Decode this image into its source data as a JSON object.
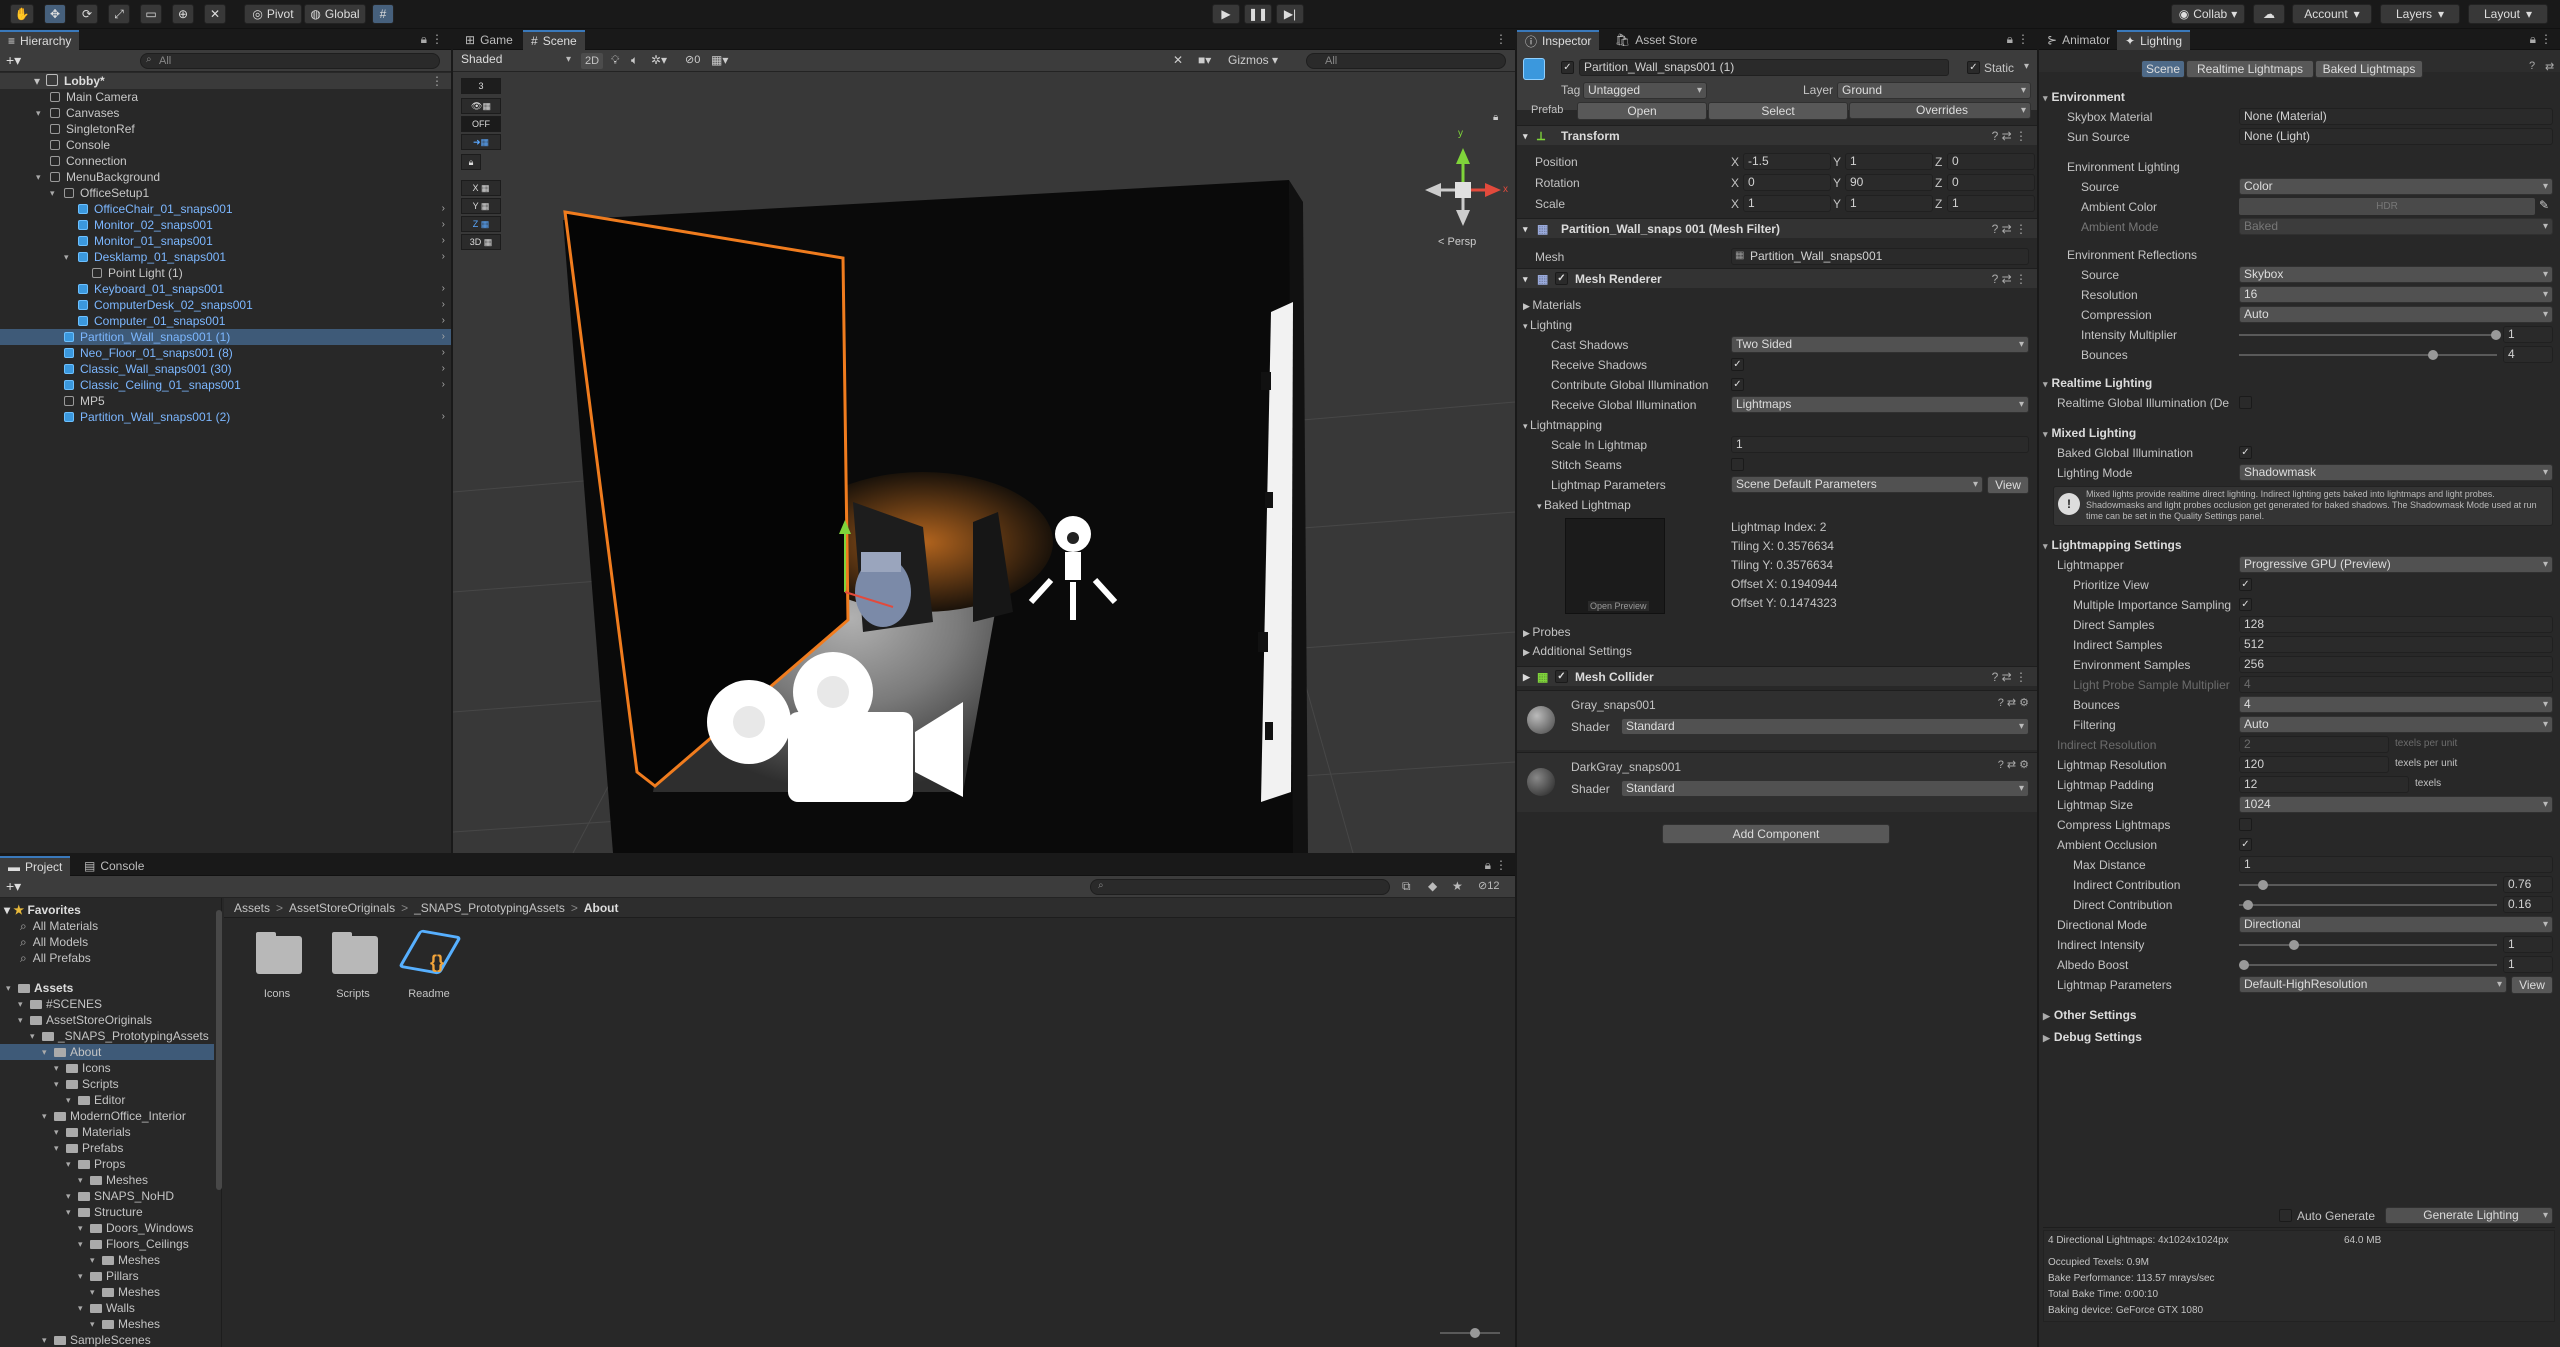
{
  "toolbar": {
    "pivot": "Pivot",
    "global": "Global",
    "collab": "Collab",
    "account": "Account",
    "layers": "Layers",
    "layout": "Layout"
  },
  "hierarchy": {
    "tab": "Hierarchy",
    "search_placeholder": "All",
    "scene": "Lobby*",
    "items": [
      {
        "label": "Main Camera",
        "indent": 1,
        "prefab": false,
        "arrow": false,
        "children": false
      },
      {
        "label": "Canvases",
        "indent": 1,
        "prefab": false,
        "arrow": true,
        "children": false
      },
      {
        "label": "SingletonRef",
        "indent": 1,
        "prefab": false,
        "arrow": false,
        "children": false
      },
      {
        "label": "Console",
        "indent": 1,
        "prefab": false,
        "arrow": false,
        "children": false
      },
      {
        "label": "Connection",
        "indent": 1,
        "prefab": false,
        "arrow": false,
        "children": false
      },
      {
        "label": "MenuBackground",
        "indent": 1,
        "prefab": false,
        "arrow": true,
        "children": false
      },
      {
        "label": "OfficeSetup1",
        "indent": 2,
        "prefab": false,
        "arrow": true,
        "children": false
      },
      {
        "label": "OfficeChair_01_snaps001",
        "indent": 3,
        "prefab": true,
        "arrow": false,
        "children": true
      },
      {
        "label": "Monitor_02_snaps001",
        "indent": 3,
        "prefab": true,
        "arrow": false,
        "children": true
      },
      {
        "label": "Monitor_01_snaps001",
        "indent": 3,
        "prefab": true,
        "arrow": false,
        "children": true
      },
      {
        "label": "Desklamp_01_snaps001",
        "indent": 3,
        "prefab": true,
        "arrow": true,
        "children": true
      },
      {
        "label": "Point Light (1)",
        "indent": 4,
        "prefab": false,
        "arrow": false,
        "children": false
      },
      {
        "label": "Keyboard_01_snaps001",
        "indent": 3,
        "prefab": true,
        "arrow": false,
        "children": true
      },
      {
        "label": "ComputerDesk_02_snaps001",
        "indent": 3,
        "prefab": true,
        "arrow": false,
        "children": true
      },
      {
        "label": "Computer_01_snaps001",
        "indent": 3,
        "prefab": true,
        "arrow": false,
        "children": true
      },
      {
        "label": "Partition_Wall_snaps001 (1)",
        "indent": 2,
        "prefab": true,
        "arrow": false,
        "children": true,
        "selected": true
      },
      {
        "label": "Neo_Floor_01_snaps001 (8)",
        "indent": 2,
        "prefab": true,
        "arrow": false,
        "children": true
      },
      {
        "label": "Classic_Wall_snaps001 (30)",
        "indent": 2,
        "prefab": true,
        "arrow": false,
        "children": true
      },
      {
        "label": "Classic_Ceiling_01_snaps001",
        "indent": 2,
        "prefab": true,
        "arrow": false,
        "children": true
      },
      {
        "label": "MP5",
        "indent": 2,
        "prefab": false,
        "arrow": false,
        "children": false
      },
      {
        "label": "Partition_Wall_snaps001 (2)",
        "indent": 2,
        "prefab": true,
        "arrow": false,
        "children": true
      }
    ]
  },
  "scene_view": {
    "tab_game": "Game",
    "tab_scene": "Scene",
    "shading": "Shaded",
    "mode_2d": "2D",
    "gizmos": "Gizmos",
    "search_placeholder": "All",
    "persp": "< Persp",
    "layer_count": "3",
    "fx_count": "0",
    "off_label": "OFF",
    "axes": [
      "X",
      "Y",
      "Z",
      "3D"
    ]
  },
  "project": {
    "tab_project": "Project",
    "tab_console": "Console",
    "breadcrumb": [
      "Assets",
      "AssetStoreOriginals",
      "_SNAPS_PrototypingAssets",
      "About"
    ],
    "badge": "12",
    "favorites": {
      "title": "Favorites",
      "items": [
        "All Materials",
        "All Models",
        "All Prefabs"
      ]
    },
    "tree": [
      {
        "label": "Assets",
        "indent": 0,
        "bold": true
      },
      {
        "label": "#SCENES",
        "indent": 1
      },
      {
        "label": "AssetStoreOriginals",
        "indent": 1
      },
      {
        "label": "_SNAPS_PrototypingAssets",
        "indent": 2
      },
      {
        "label": "About",
        "indent": 3,
        "selected": true
      },
      {
        "label": "Icons",
        "indent": 4
      },
      {
        "label": "Scripts",
        "indent": 4
      },
      {
        "label": "Editor",
        "indent": 5
      },
      {
        "label": "ModernOffice_Interior",
        "indent": 3
      },
      {
        "label": "Materials",
        "indent": 4
      },
      {
        "label": "Prefabs",
        "indent": 4
      },
      {
        "label": "Props",
        "indent": 5
      },
      {
        "label": "Meshes",
        "indent": 6
      },
      {
        "label": "SNAPS_NoHD",
        "indent": 5
      },
      {
        "label": "Structure",
        "indent": 5
      },
      {
        "label": "Doors_Windows",
        "indent": 6
      },
      {
        "label": "Floors_Ceilings",
        "indent": 6
      },
      {
        "label": "Meshes",
        "indent": 7
      },
      {
        "label": "Pillars",
        "indent": 6
      },
      {
        "label": "Meshes",
        "indent": 7
      },
      {
        "label": "Walls",
        "indent": 6
      },
      {
        "label": "Meshes",
        "indent": 7
      },
      {
        "label": "SampleScenes",
        "indent": 3
      }
    ],
    "assets": [
      {
        "label": "Icons",
        "type": "folder"
      },
      {
        "label": "Scripts",
        "type": "folder"
      },
      {
        "label": "Readme",
        "type": "asset"
      }
    ]
  },
  "inspector": {
    "tab_inspector": "Inspector",
    "tab_asset_store": "Asset Store",
    "object_name": "Partition_Wall_snaps001 (1)",
    "static_label": "Static",
    "tag_label": "Tag",
    "tag_value": "Untagged",
    "layer_label": "Layer",
    "layer_value": "Ground",
    "prefab_label": "Prefab",
    "prefab_open": "Open",
    "prefab_select": "Select",
    "prefab_overrides": "Overrides",
    "transform": {
      "title": "Transform",
      "rows": [
        {
          "label": "Position",
          "x": "-1.5",
          "y": "1",
          "z": "0"
        },
        {
          "label": "Rotation",
          "x": "0",
          "y": "90",
          "z": "0"
        },
        {
          "label": "Scale",
          "x": "1",
          "y": "1",
          "z": "1"
        }
      ]
    },
    "mesh_filter": {
      "title": "Partition_Wall_snaps 001 (Mesh Filter)",
      "mesh_label": "Mesh",
      "mesh_value": "Partition_Wall_snaps001"
    },
    "mesh_renderer": {
      "title": "Mesh Renderer",
      "materials": "Materials",
      "lighting": "Lighting",
      "cast_shadows_label": "Cast Shadows",
      "cast_shadows_value": "Two Sided",
      "receive_shadows": "Receive Shadows",
      "contribute_gi": "Contribute Global Illumination",
      "receive_gi_label": "Receive Global Illumination",
      "receive_gi_value": "Lightmaps",
      "lightmapping": "Lightmapping",
      "scale_label": "Scale In Lightmap",
      "scale_value": "1",
      "stitch_seams": "Stitch Seams",
      "lm_params_label": "Lightmap Parameters",
      "lm_params_value": "Scene Default Parameters",
      "view": "View",
      "baked_lightmap": "Baked Lightmap",
      "open_preview": "Open Preview",
      "lightmap_info": [
        "Lightmap Index: 2",
        "Tiling X: 0.3576634",
        "Tiling Y: 0.3576634",
        "Offset X: 0.1940944",
        "Offset Y: 0.1474323"
      ],
      "probes": "Probes",
      "additional": "Additional Settings"
    },
    "mesh_collider": {
      "title": "Mesh Collider"
    },
    "materials": [
      {
        "name": "Gray_snaps001",
        "shader_label": "Shader",
        "shader": "Standard"
      },
      {
        "name": "DarkGray_snaps001",
        "shader_label": "Shader",
        "shader": "Standard"
      }
    ],
    "add_component": "Add Component"
  },
  "lighting": {
    "tab_animator": "Animator",
    "tab_lighting": "Lighting",
    "subtabs": [
      "Scene",
      "Realtime Lightmaps",
      "Baked Lightmaps"
    ],
    "environment": {
      "title": "Environment",
      "skybox_label": "Skybox Material",
      "skybox_value": "None (Material)",
      "sun_label": "Sun Source",
      "sun_value": "None (Light)",
      "env_lighting": "Environment Lighting",
      "source_label": "Source",
      "source_value": "Color",
      "ambient_color_label": "Ambient Color",
      "ambient_color_value": "HDR",
      "ambient_mode_label": "Ambient Mode",
      "ambient_mode_value": "Baked",
      "env_reflections": "Environment Reflections",
      "ref_source_label": "Source",
      "ref_source_value": "Skybox",
      "resolution_label": "Resolution",
      "resolution_value": "16",
      "compression_label": "Compression",
      "compression_value": "Auto",
      "intensity_label": "Intensity Multiplier",
      "intensity_value": "1",
      "intensity_fraction": 1.0,
      "bounces_label": "Bounces",
      "bounces_value": "4",
      "bounces_fraction": 0.75
    },
    "realtime": {
      "title": "Realtime Lighting",
      "rgi_label": "Realtime Global Illumination (De"
    },
    "mixed": {
      "title": "Mixed Lighting",
      "bgi_label": "Baked Global Illumination",
      "mode_label": "Lighting Mode",
      "mode_value": "Shadowmask",
      "info": "Mixed lights provide realtime direct lighting. Indirect lighting gets baked into lightmaps and light probes. Shadowmasks and light probes occlusion get generated for baked shadows. The Shadowmask Mode used at run time can be set in the Quality Settings panel."
    },
    "lm_settings": {
      "title": "Lightmapping Settings",
      "lightmapper_label": "Lightmapper",
      "lightmapper_value": "Progressive GPU (Preview)",
      "prioritize_label": "Prioritize View",
      "mis_label": "Multiple Importance Sampling",
      "direct_samples_label": "Direct Samples",
      "direct_samples_value": "128",
      "indirect_samples_label": "Indirect Samples",
      "indirect_samples_value": "512",
      "env_samples_label": "Environment Samples",
      "env_samples_value": "256",
      "probe_mult_label": "Light Probe Sample Multiplier",
      "probe_mult_value": "4",
      "bounces_label": "Bounces",
      "bounces_value": "4",
      "filtering_label": "Filtering",
      "filtering_value": "Auto",
      "indirect_res_label": "Indirect Resolution",
      "indirect_res_value": "2",
      "texels_per_unit": "texels per unit",
      "lm_res_label": "Lightmap Resolution",
      "lm_res_value": "120",
      "padding_label": "Lightmap Padding",
      "padding_value": "12",
      "texels": "texels",
      "size_label": "Lightmap Size",
      "size_value": "1024",
      "compress_label": "Compress Lightmaps",
      "ao_label": "Ambient Occlusion",
      "max_distance_label": "Max Distance",
      "max_distance_value": "1",
      "ind_contrib_label": "Indirect Contribution",
      "ind_contrib_value": "0.76",
      "ind_contrib_fraction": 0.076,
      "dir_contrib_label": "Direct Contribution",
      "dir_contrib_value": "0.16",
      "dir_contrib_fraction": 0.016,
      "dir_mode_label": "Directional Mode",
      "dir_mode_value": "Directional",
      "indirect_intensity_label": "Indirect Intensity",
      "indirect_intensity_value": "1",
      "indirect_intensity_fraction": 0.2,
      "albedo_label": "Albedo Boost",
      "albedo_value": "1",
      "albedo_fraction": 0.0,
      "params_label": "Lightmap Parameters",
      "params_value": "Default-HighResolution",
      "view": "View"
    },
    "other": "Other Settings",
    "debug": "Debug Settings",
    "auto_generate": "Auto Generate",
    "generate": "Generate Lighting",
    "stats": {
      "lightmaps": "4 Directional Lightmaps: 4x1024x1024px",
      "size": "64.0 MB",
      "texels": "Occupied Texels: 0.9M",
      "performance": "Bake Performance: 113.57 mrays/sec",
      "bake_time": "Total Bake Time: 0:00:10",
      "device": "Baking device: GeForce GTX 1080"
    }
  },
  "colors": {
    "accent": "#3a79bb",
    "selection": "#2c5d87",
    "prefab_text": "#7cb7ff",
    "outline": "#f07c1e"
  }
}
